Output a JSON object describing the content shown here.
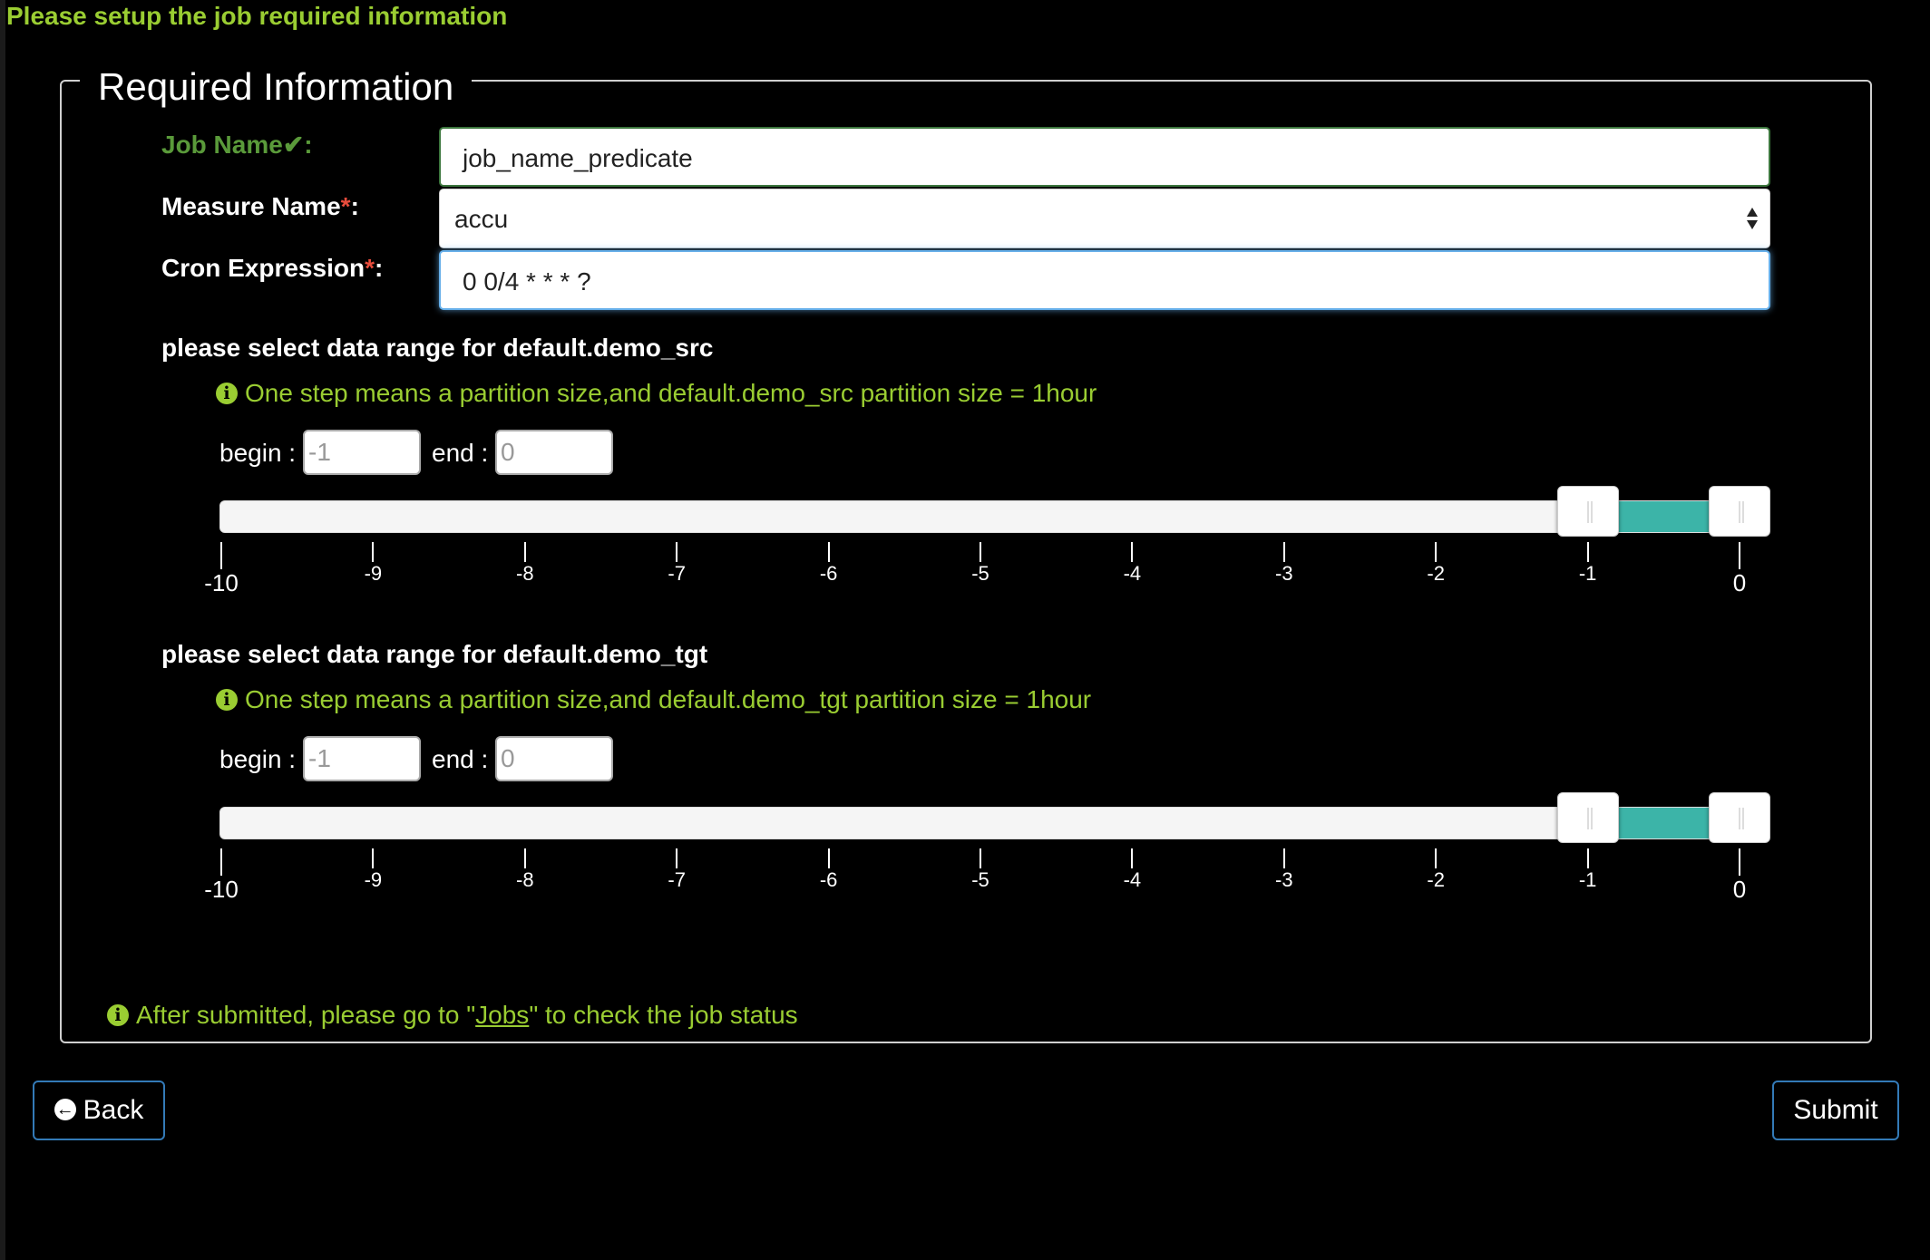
{
  "header": {
    "title": "Please setup the job required information"
  },
  "form": {
    "legend": "Required Information",
    "job_name": {
      "label": "Job Name",
      "suffix": ":",
      "value": "job_name_predicate"
    },
    "measure_name": {
      "label": "Measure Name",
      "required_mark": "*",
      "suffix": ":",
      "selected": "accu"
    },
    "cron": {
      "label": "Cron Expression",
      "required_mark": "*",
      "suffix": ":",
      "value": "0 0/4 * * * ?"
    }
  },
  "ranges": [
    {
      "title": "please select data range for default.demo_src",
      "info": "One step means a partition size,and default.demo_src partition size = 1hour",
      "begin_label": "begin :",
      "begin_value": "-1",
      "end_label": "end :",
      "end_value": "0",
      "slider": {
        "min": -10,
        "max": 0,
        "low": -1,
        "high": 0
      },
      "ticks": [
        "-10",
        "-9",
        "-8",
        "-7",
        "-6",
        "-5",
        "-4",
        "-3",
        "-2",
        "-1",
        "0"
      ]
    },
    {
      "title": "please select data range for default.demo_tgt",
      "info": "One step means a partition size,and default.demo_tgt partition size = 1hour",
      "begin_label": "begin :",
      "begin_value": "-1",
      "end_label": "end :",
      "end_value": "0",
      "slider": {
        "min": -10,
        "max": 0,
        "low": -1,
        "high": 0
      },
      "ticks": [
        "-10",
        "-9",
        "-8",
        "-7",
        "-6",
        "-5",
        "-4",
        "-3",
        "-2",
        "-1",
        "0"
      ]
    }
  ],
  "footer": {
    "info_before": "After submitted, please go to \"",
    "link": "Jobs",
    "info_after": "\" to check the job status"
  },
  "buttons": {
    "back": "Back",
    "submit": "Submit"
  },
  "icons": {
    "info": "info-circle-icon",
    "valid": "check-icon",
    "back": "arrow-circle-left-icon",
    "select": "sort-arrows-icon"
  },
  "colors": {
    "accent": "#9acd32",
    "valid": "#5a9a3a",
    "required": "#e74c3c",
    "slider_fill": "#3cb4a8",
    "button_border": "#337ab7"
  }
}
